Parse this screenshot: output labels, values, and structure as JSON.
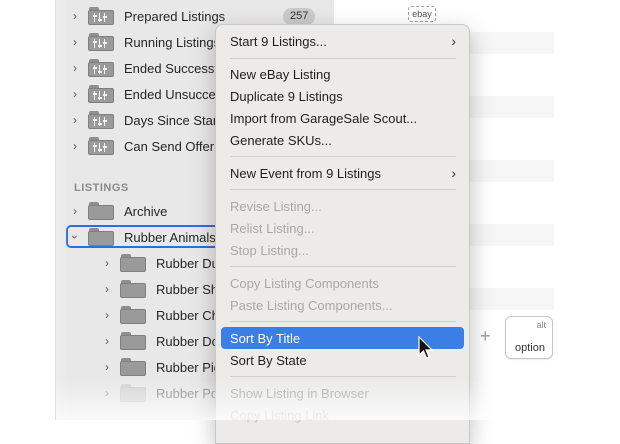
{
  "sidebar": {
    "smart_items": [
      {
        "label": "Prepared Listings",
        "count": "257"
      },
      {
        "label": "Running Listings"
      },
      {
        "label": "Ended Successf"
      },
      {
        "label": "Ended Unsucce"
      },
      {
        "label": "Days Since Start"
      },
      {
        "label": "Can Send Offer"
      }
    ],
    "section_header": "LISTINGS",
    "folders": [
      {
        "label": "Archive"
      },
      {
        "label": "Rubber Animals"
      }
    ],
    "subfolders": [
      {
        "label": "Rubber Du"
      },
      {
        "label": "Rubber She"
      },
      {
        "label": "Rubber Ch"
      },
      {
        "label": "Rubber Do"
      },
      {
        "label": "Rubber Pig"
      },
      {
        "label": "Rubber Po"
      }
    ]
  },
  "menu": {
    "items": [
      {
        "label": "Start 9 Listings...",
        "submenu": true
      },
      {
        "label": "New eBay Listing"
      },
      {
        "label": "Duplicate 9 Listings"
      },
      {
        "label": "Import from GarageSale Scout..."
      },
      {
        "label": "Generate SKUs..."
      },
      {
        "label": "New Event from 9 Listings",
        "submenu": true
      },
      {
        "label": "Revise Listing...",
        "disabled": true
      },
      {
        "label": "Relist Listing...",
        "disabled": true
      },
      {
        "label": "Stop Listing...",
        "disabled": true
      },
      {
        "label": "Copy Listing Components",
        "disabled": true
      },
      {
        "label": "Paste Listing Components...",
        "disabled": true
      },
      {
        "label": "Sort By Title",
        "highlighted": true
      },
      {
        "label": "Sort By State"
      },
      {
        "label": "Show Listing in Browser",
        "disabled": true
      },
      {
        "label": "Copy Listing Link",
        "disabled": true
      }
    ],
    "submenu_glyph": "›"
  },
  "content": {
    "ebay_tag": "ebay",
    "plus": "+",
    "key_top": "alt",
    "key_bottom": "option"
  },
  "colors": {
    "highlight": "#3b7ee6",
    "selection_outline": "#2f6fd8"
  }
}
